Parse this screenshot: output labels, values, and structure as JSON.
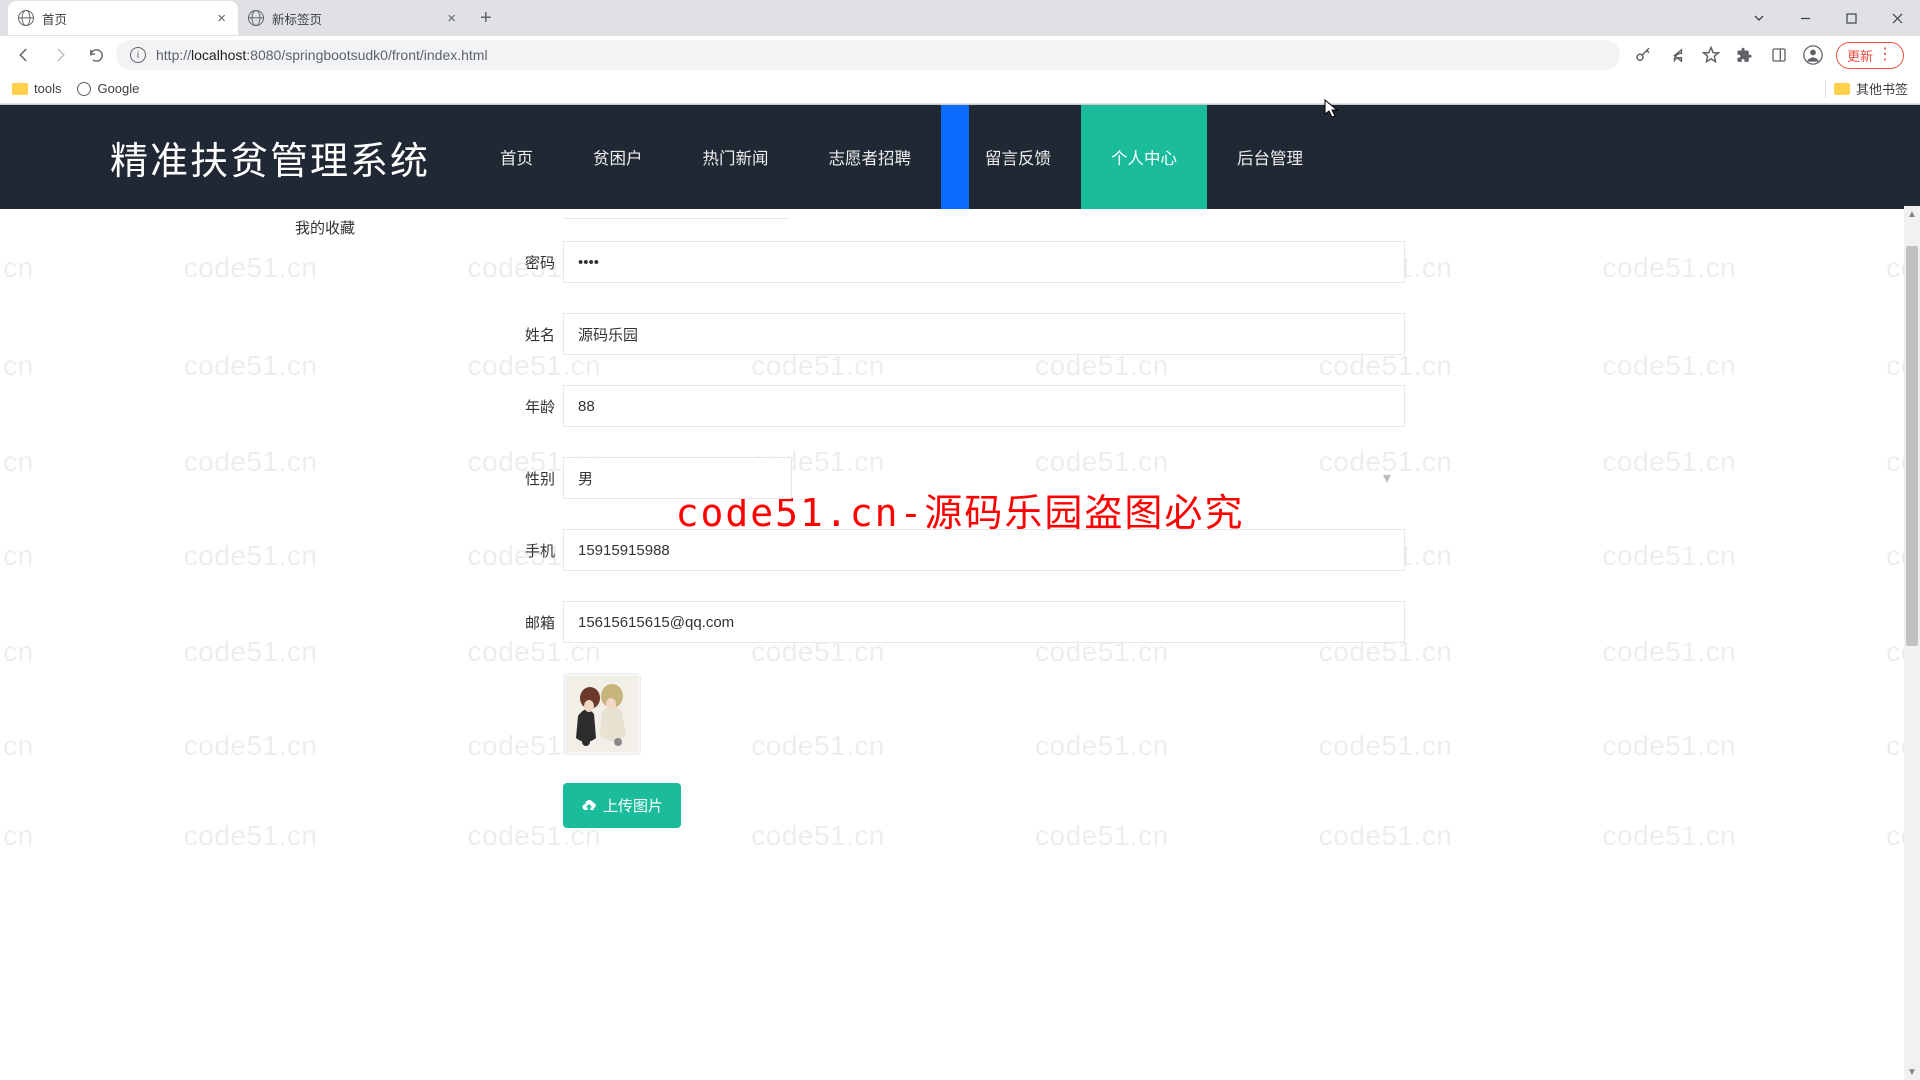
{
  "browser": {
    "tabs": [
      {
        "title": "首页",
        "active": true
      },
      {
        "title": "新标签页",
        "active": false
      }
    ],
    "url_host": "localhost",
    "url_port": ":8080",
    "url_path": "/springbootsudk0/front/index.html",
    "url_prefix": "http://",
    "update_label": "更新",
    "bookmarks": {
      "tools": "tools",
      "google": "Google",
      "other": "其他书签"
    }
  },
  "watermark": {
    "text": "code51.cn",
    "center": "code51.cn-源码乐园盗图必究"
  },
  "header": {
    "logo": "精准扶贫管理系统",
    "nav": [
      "首页",
      "贫困户",
      "热门新闻",
      "志愿者招聘",
      "留言反馈",
      "个人中心",
      "后台管理"
    ]
  },
  "sidebar": {
    "items": [
      "我的收藏"
    ]
  },
  "form": {
    "password": {
      "label": "密码",
      "value": "••••"
    },
    "name": {
      "label": "姓名",
      "value": "源码乐园"
    },
    "age": {
      "label": "年龄",
      "value": "88"
    },
    "gender": {
      "label": "性别",
      "value": "男"
    },
    "phone": {
      "label": "手机",
      "value": "15915915988"
    },
    "email": {
      "label": "邮箱",
      "value": "15615615615@qq.com"
    },
    "upload_label": "上传图片"
  }
}
